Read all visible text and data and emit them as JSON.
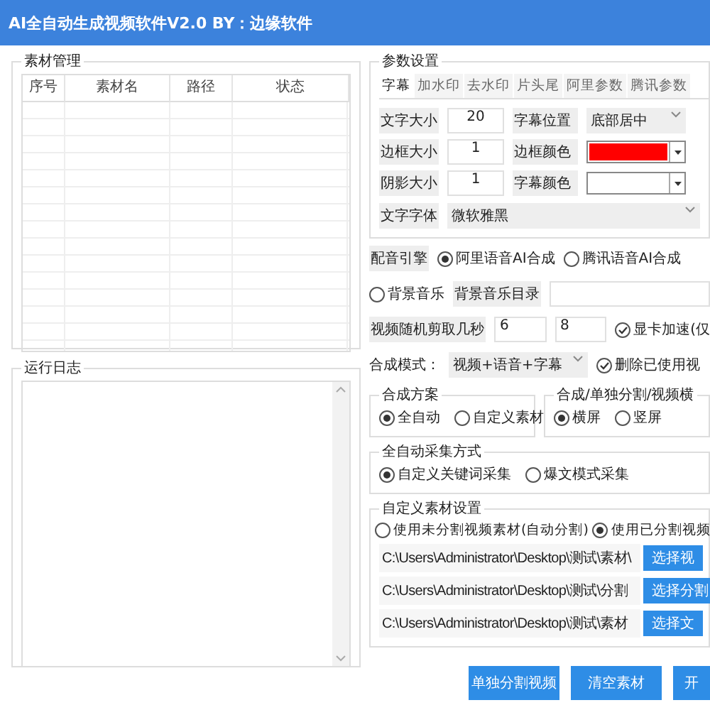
{
  "window": {
    "title": "AI全自动生成视频软件V2.0  BY：边缘软件"
  },
  "materials": {
    "title": "素材管理",
    "columns": [
      "序号",
      "素材名",
      "路径",
      "状态"
    ]
  },
  "log": {
    "title": "运行日志"
  },
  "params": {
    "title": "参数设置",
    "tabs": [
      {
        "label": "字幕",
        "selected": true
      },
      {
        "label": "加水印",
        "selected": false
      },
      {
        "label": "去水印",
        "selected": false
      },
      {
        "label": "片头尾",
        "selected": false
      },
      {
        "label": "阿里参数",
        "selected": false
      },
      {
        "label": "腾讯参数",
        "selected": false
      }
    ],
    "fields": [
      {
        "label": "文字大小",
        "kind": "number",
        "value": "20"
      },
      {
        "label": "字幕位置",
        "kind": "select",
        "value": "底部居中"
      },
      {
        "label": "边框大小",
        "kind": "number",
        "value": "1"
      },
      {
        "label": "边框颜色",
        "kind": "color",
        "color": "#ff0000"
      },
      {
        "label": "阴影大小",
        "kind": "number",
        "value": "1"
      },
      {
        "label": "字幕颜色",
        "kind": "color",
        "color": "#ffffff"
      }
    ],
    "font": {
      "label": "文字字体",
      "value": "微软雅黑"
    }
  },
  "voice": {
    "label": "配音引擎",
    "options": [
      {
        "label": "阿里语音AI合成",
        "selected": true
      },
      {
        "label": "腾讯语音AI合成",
        "selected": false
      }
    ]
  },
  "music": {
    "option": {
      "label": "背景音乐",
      "selected": false
    },
    "dir_label": "背景音乐目录"
  },
  "clip": {
    "label": "视频随机剪取几秒",
    "min": "6",
    "max": "8",
    "checkbox": {
      "label": "显卡加速(仅",
      "checked": true
    }
  },
  "mode": {
    "label": "合成模式：",
    "value": "视频+语音+字幕",
    "checkbox": {
      "label": "删除已使用视",
      "checked": true
    }
  },
  "scheme": {
    "title": "合成方案",
    "options": [
      {
        "label": "全自动",
        "selected": true
      },
      {
        "label": "自定义素材",
        "selected": false
      }
    ]
  },
  "orientation": {
    "title": "合成/单独分割/视频横",
    "options": [
      {
        "label": "横屏",
        "selected": true
      },
      {
        "label": "竖屏",
        "selected": false
      }
    ]
  },
  "collect": {
    "title": "全自动采集方式",
    "options": [
      {
        "label": "自定义关键词采集",
        "selected": true
      },
      {
        "label": "爆文模式采集",
        "selected": false
      }
    ]
  },
  "custom": {
    "title": "自定义素材设置",
    "options": [
      {
        "label": "使用未分割视频素材(自动分割)",
        "selected": false
      },
      {
        "label": "使用已分割视频",
        "selected": true
      }
    ],
    "paths": [
      {
        "value": "C:\\Users\\Administrator\\Desktop\\测试\\素材\\",
        "button": "选择视"
      },
      {
        "value": "C:\\Users\\Administrator\\Desktop\\测试\\分割",
        "button": "选择分割"
      },
      {
        "value": "C:\\Users\\Administrator\\Desktop\\测试\\素材",
        "button": "选择文"
      }
    ]
  },
  "buttons": [
    "单独分割视频",
    "清空素材",
    "开"
  ]
}
